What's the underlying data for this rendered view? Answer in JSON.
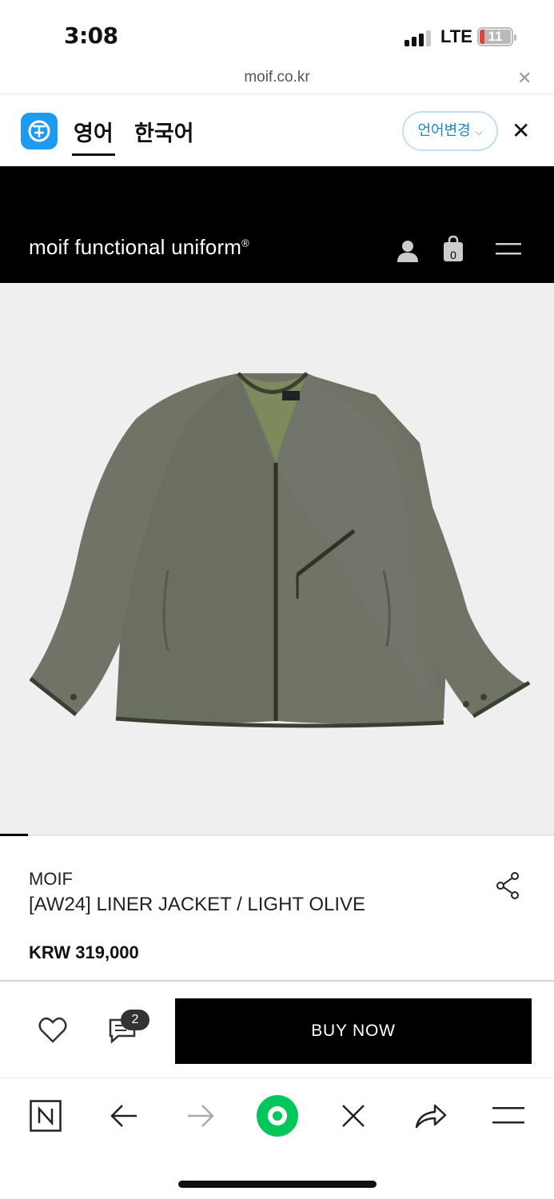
{
  "status": {
    "time": "3:08",
    "network": "LTE",
    "battery": "11"
  },
  "browser": {
    "url": "moif.co.kr"
  },
  "translate": {
    "tab_en": "영어",
    "tab_ko": "한국어",
    "change_lang": "언어변경"
  },
  "site": {
    "logo": "moif functional uniform",
    "logo_mark": "®",
    "cart_count": "0"
  },
  "product": {
    "brand": "MOIF",
    "name": "[AW24] LINER JACKET / LIGHT OLIVE",
    "price": "KRW 319,000",
    "image_slide": 1
  },
  "actions": {
    "review_count": "2",
    "buy_label": "BUY NOW"
  },
  "colors": {
    "accent_blue": "#1d9bf0",
    "header_bg": "#000000",
    "jacket": "#6d7264",
    "naver_green": "#03c75a"
  },
  "icons": [
    "close-icon",
    "translate-logo-icon",
    "user-icon",
    "shopping-bag-icon",
    "menu-icon",
    "share-icon",
    "heart-icon",
    "review-icon",
    "naver-icon",
    "back-icon",
    "forward-icon",
    "green-dot-icon",
    "close-tab-icon",
    "share-arrow-icon",
    "browser-menu-icon"
  ]
}
